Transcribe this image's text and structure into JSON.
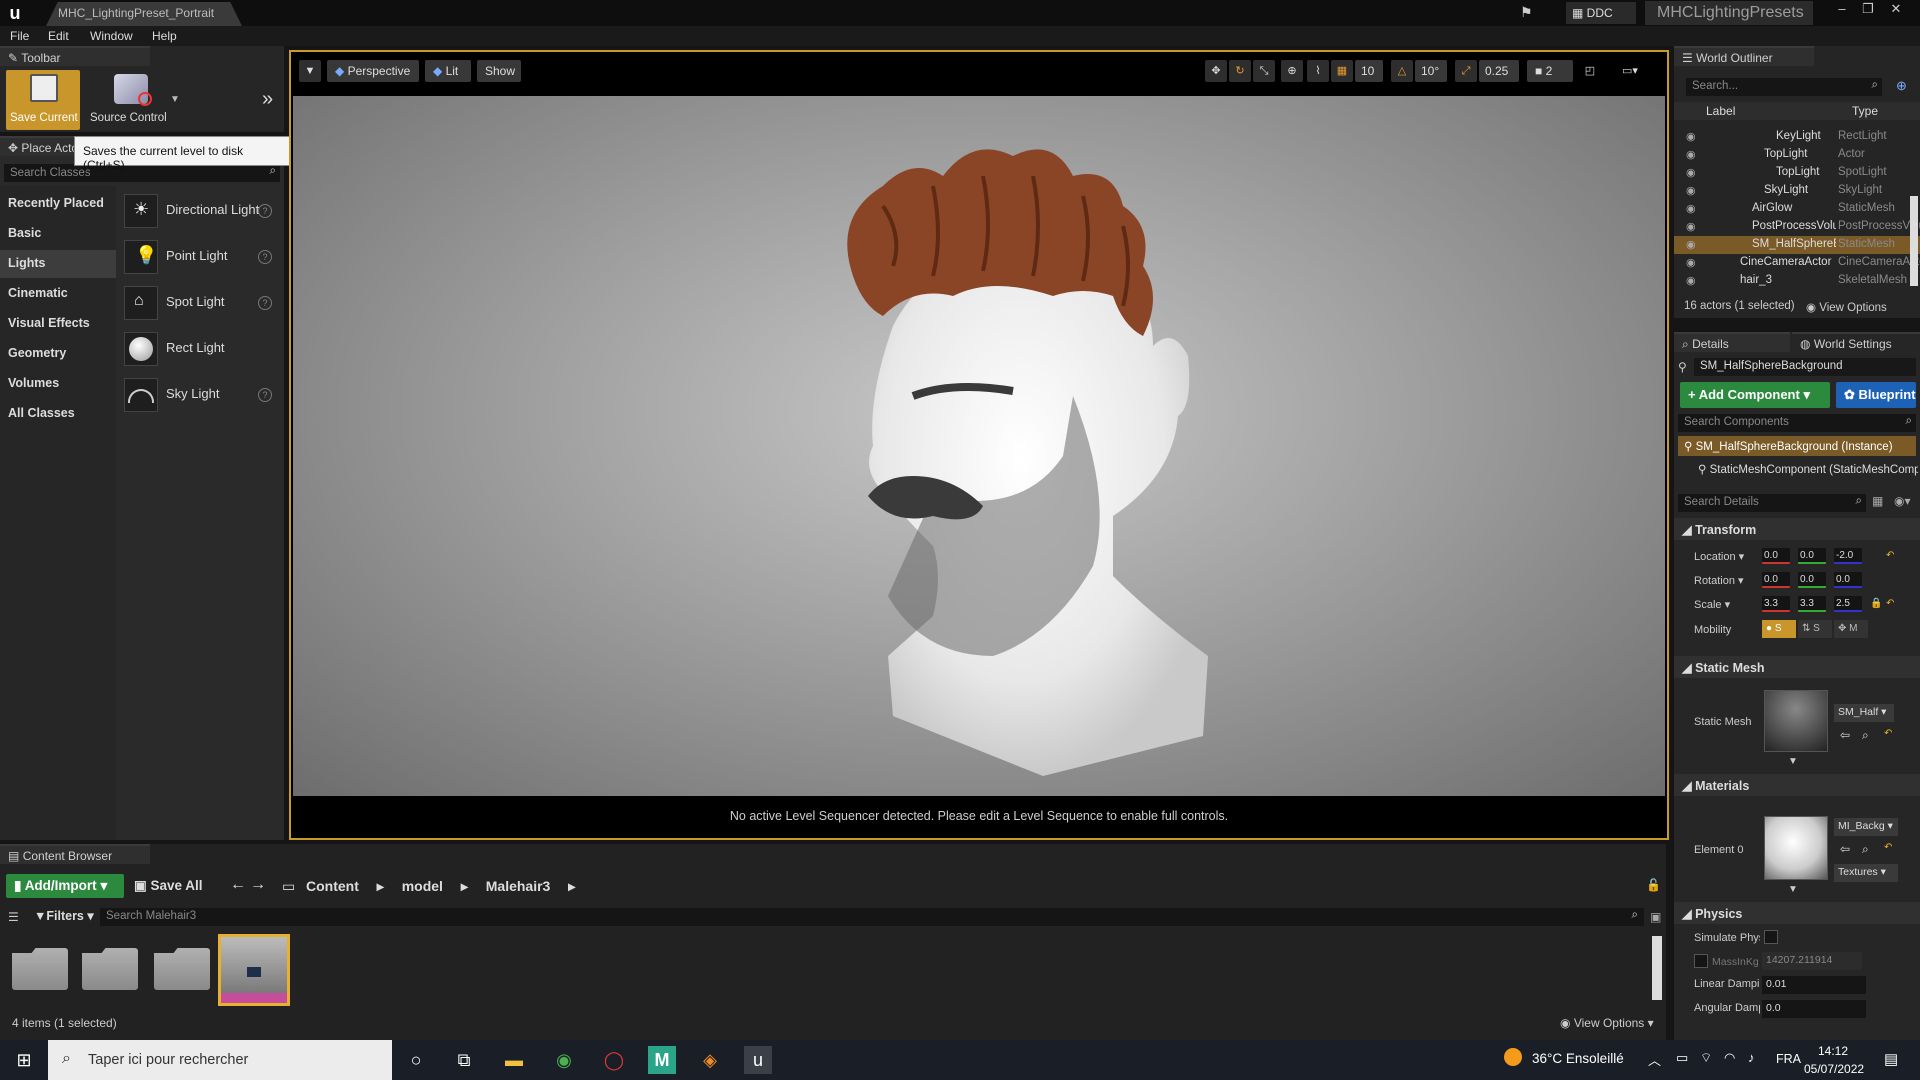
{
  "titlebar": {
    "doc_tab": "MHC_LightingPreset_Portrait",
    "ddc_label": "DDC",
    "project_name": "MHCLightingPresets"
  },
  "menu": [
    "File",
    "Edit",
    "Window",
    "Help"
  ],
  "toolbar": {
    "tab_label": "Toolbar",
    "save_label": "Save Current",
    "source_control_label": "Source Control",
    "tooltip": "Saves the current level to disk (Ctrl+S)"
  },
  "place_actors": {
    "tab_label": "Place Actors",
    "search_placeholder": "Search Classes",
    "categories": [
      "Recently Placed",
      "Basic",
      "Lights",
      "Cinematic",
      "Visual Effects",
      "Geometry",
      "Volumes",
      "All Classes"
    ],
    "active_category": "Lights",
    "items": [
      "Directional Light",
      "Point Light",
      "Spot Light",
      "Rect Light",
      "Sky Light"
    ]
  },
  "viewport": {
    "perspective_label": "Perspective",
    "lit_label": "Lit",
    "show_label": "Show",
    "grid_snap": "10",
    "rot_snap": "10°",
    "scale_snap": "0.25",
    "camera_speed": "2",
    "status": "No active Level Sequencer detected. Please edit a Level Sequence to enable full controls."
  },
  "outliner": {
    "tab_label": "World Outliner",
    "search_placeholder": "Search...",
    "col_label": "Label",
    "col_type": "Type",
    "rows": [
      {
        "label": "KeyLight",
        "type": "RectLight",
        "indent": 3
      },
      {
        "label": "TopLight",
        "type": "Actor",
        "indent": 2
      },
      {
        "label": "TopLight",
        "type": "SpotLight",
        "indent": 3
      },
      {
        "label": "SkyLight",
        "type": "SkyLight",
        "indent": 2
      },
      {
        "label": "AirGlow",
        "type": "StaticMesh",
        "indent": 1
      },
      {
        "label": "PostProcessVolume",
        "type": "PostProcessVolume",
        "indent": 1
      },
      {
        "label": "SM_HalfSphereBackground",
        "type": "StaticMesh",
        "indent": 1
      },
      {
        "label": "CineCameraActor",
        "type": "CineCameraActor",
        "indent": 0
      },
      {
        "label": "hair_3",
        "type": "SkeletalMesh",
        "indent": 0
      }
    ],
    "selected_index": 6,
    "footer": "16 actors (1 selected)",
    "view_options": "View Options"
  },
  "details": {
    "tab_label": "Details",
    "world_tab_label": "World Settings",
    "object_name": "SM_HalfSphereBackground",
    "add_component": "+ Add Component",
    "blueprint": "Blueprint",
    "search_components_placeholder": "Search Components",
    "instance_label": "SM_HalfSphereBackground (Instance)",
    "component_label": "StaticMeshComponent (StaticMeshComponent)",
    "search_details_placeholder": "Search Details",
    "transform_label": "Transform",
    "location_label": "Location",
    "rotation_label": "Rotation",
    "scale_label": "Scale",
    "mobility_label": "Mobility",
    "location": [
      "0.0",
      "0.0",
      "-2.0"
    ],
    "rotation": [
      "0.0",
      "0.0",
      "0.0"
    ],
    "scale": [
      "3.3",
      "3.3",
      "2.5"
    ],
    "mobility": [
      "S",
      "S",
      "M"
    ],
    "static_mesh_section": "Static Mesh",
    "static_mesh_label": "Static Mesh",
    "static_mesh_value": "SM_Half",
    "materials_section": "Materials",
    "element0_label": "Element 0",
    "material_value": "MI_Backg",
    "textures_label": "Textures",
    "physics_section": "Physics",
    "simulate_label": "Simulate Physics",
    "mass_label": "MassInKg",
    "mass_value": "14207.211914",
    "linear_damp_label": "Linear Damping",
    "linear_damp_value": "0.01",
    "angular_damp_label": "Angular Damping",
    "angular_damp_value": "0.0"
  },
  "content_browser": {
    "tab_label": "Content Browser",
    "add_import": "Add/Import",
    "save_all": "Save All",
    "breadcrumb": [
      "Content",
      "model",
      "Malehair3"
    ],
    "filters": "Filters",
    "search_placeholder": "Search Malehair3",
    "status": "4 items (1 selected)",
    "view_options": "View Options"
  },
  "taskbar": {
    "search_placeholder": "Taper ici pour rechercher",
    "weather": "36°C Ensoleillé",
    "lang": "FRA",
    "time": "14:12",
    "date": "05/07/2022"
  }
}
